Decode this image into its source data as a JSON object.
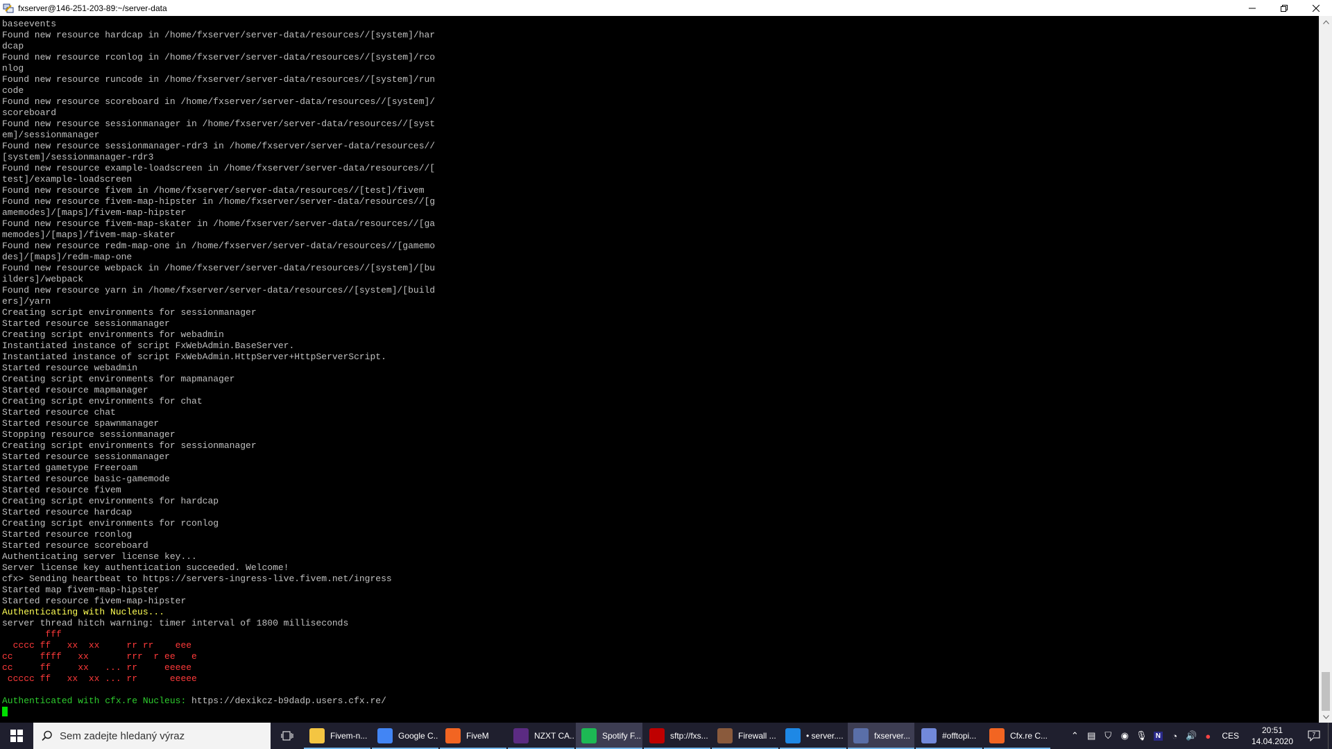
{
  "window": {
    "title": "fxserver@146-251-203-89:~/server-data"
  },
  "terminal": {
    "lines": [
      {
        "text": "baseevents",
        "color": "default"
      },
      {
        "text": "Found new resource hardcap in /home/fxserver/server-data/resources//[system]/har",
        "color": "default"
      },
      {
        "text": "dcap",
        "color": "default"
      },
      {
        "text": "Found new resource rconlog in /home/fxserver/server-data/resources//[system]/rco",
        "color": "default"
      },
      {
        "text": "nlog",
        "color": "default"
      },
      {
        "text": "Found new resource runcode in /home/fxserver/server-data/resources//[system]/run",
        "color": "default"
      },
      {
        "text": "code",
        "color": "default"
      },
      {
        "text": "Found new resource scoreboard in /home/fxserver/server-data/resources//[system]/",
        "color": "default"
      },
      {
        "text": "scoreboard",
        "color": "default"
      },
      {
        "text": "Found new resource sessionmanager in /home/fxserver/server-data/resources//[syst",
        "color": "default"
      },
      {
        "text": "em]/sessionmanager",
        "color": "default"
      },
      {
        "text": "Found new resource sessionmanager-rdr3 in /home/fxserver/server-data/resources//",
        "color": "default"
      },
      {
        "text": "[system]/sessionmanager-rdr3",
        "color": "default"
      },
      {
        "text": "Found new resource example-loadscreen in /home/fxserver/server-data/resources//[",
        "color": "default"
      },
      {
        "text": "test]/example-loadscreen",
        "color": "default"
      },
      {
        "text": "Found new resource fivem in /home/fxserver/server-data/resources//[test]/fivem",
        "color": "default"
      },
      {
        "text": "Found new resource fivem-map-hipster in /home/fxserver/server-data/resources//[g",
        "color": "default"
      },
      {
        "text": "amemodes]/[maps]/fivem-map-hipster",
        "color": "default"
      },
      {
        "text": "Found new resource fivem-map-skater in /home/fxserver/server-data/resources//[ga",
        "color": "default"
      },
      {
        "text": "memodes]/[maps]/fivem-map-skater",
        "color": "default"
      },
      {
        "text": "Found new resource redm-map-one in /home/fxserver/server-data/resources//[gamemo",
        "color": "default"
      },
      {
        "text": "des]/[maps]/redm-map-one",
        "color": "default"
      },
      {
        "text": "Found new resource webpack in /home/fxserver/server-data/resources//[system]/[bu",
        "color": "default"
      },
      {
        "text": "ilders]/webpack",
        "color": "default"
      },
      {
        "text": "Found new resource yarn in /home/fxserver/server-data/resources//[system]/[build",
        "color": "default"
      },
      {
        "text": "ers]/yarn",
        "color": "default"
      },
      {
        "text": "Creating script environments for sessionmanager",
        "color": "default"
      },
      {
        "text": "Started resource sessionmanager",
        "color": "default"
      },
      {
        "text": "Creating script environments for webadmin",
        "color": "default"
      },
      {
        "text": "Instantiated instance of script FxWebAdmin.BaseServer.",
        "color": "default"
      },
      {
        "text": "Instantiated instance of script FxWebAdmin.HttpServer+HttpServerScript.",
        "color": "default"
      },
      {
        "text": "Started resource webadmin",
        "color": "default"
      },
      {
        "text": "Creating script environments for mapmanager",
        "color": "default"
      },
      {
        "text": "Started resource mapmanager",
        "color": "default"
      },
      {
        "text": "Creating script environments for chat",
        "color": "default"
      },
      {
        "text": "Started resource chat",
        "color": "default"
      },
      {
        "text": "Started resource spawnmanager",
        "color": "default"
      },
      {
        "text": "Stopping resource sessionmanager",
        "color": "default"
      },
      {
        "text": "Creating script environments for sessionmanager",
        "color": "default"
      },
      {
        "text": "Started resource sessionmanager",
        "color": "default"
      },
      {
        "text": "Started gametype Freeroam",
        "color": "default"
      },
      {
        "text": "Started resource basic-gamemode",
        "color": "default"
      },
      {
        "text": "Started resource fivem",
        "color": "default"
      },
      {
        "text": "Creating script environments for hardcap",
        "color": "default"
      },
      {
        "text": "Started resource hardcap",
        "color": "default"
      },
      {
        "text": "Creating script environments for rconlog",
        "color": "default"
      },
      {
        "text": "Started resource rconlog",
        "color": "default"
      },
      {
        "text": "Started resource scoreboard",
        "color": "default"
      },
      {
        "text": "Authenticating server license key...",
        "color": "default"
      },
      {
        "text": "Server license key authentication succeeded. Welcome!",
        "color": "default"
      },
      {
        "text": "cfx> Sending heartbeat to https://servers-ingress-live.fivem.net/ingress",
        "color": "default"
      },
      {
        "text": "Started map fivem-map-hipster",
        "color": "default"
      },
      {
        "text": "Started resource fivem-map-hipster",
        "color": "default"
      },
      {
        "text": "Authenticating with Nucleus...",
        "color": "yellow"
      },
      {
        "text": "server thread hitch warning: timer interval of 1800 milliseconds",
        "color": "default"
      },
      {
        "text": "        fff",
        "color": "red"
      },
      {
        "text": "  cccc ff   xx  xx     rr rr    eee",
        "color": "red"
      },
      {
        "text": "cc     ffff   xx       rrr  r ee   e",
        "color": "red"
      },
      {
        "text": "cc     ff     xx   ... rr     eeeee",
        "color": "red"
      },
      {
        "text": " ccccc ff   xx  xx ... rr      eeeee",
        "color": "red"
      },
      {
        "text": "",
        "color": "default"
      },
      {
        "text": "Authenticated with cfx.re Nucleus: https://dexikcz-b9dadp.users.cfx.re/",
        "color": "green-prefix"
      }
    ]
  },
  "taskbar": {
    "search_placeholder": "Sem zadejte hledaný výraz",
    "apps": [
      {
        "label": "Fivem-n...",
        "icon": "folder-icon",
        "color": "#f4c542",
        "active": false,
        "underline": true
      },
      {
        "label": "Google C...",
        "icon": "chrome-icon",
        "color": "#4285f4",
        "active": false,
        "underline": true
      },
      {
        "label": "FiveM",
        "icon": "fivem-icon",
        "color": "#f26522",
        "active": false,
        "underline": true
      },
      {
        "label": "NZXT CA...",
        "icon": "nzxt-icon",
        "color": "#5b2b82",
        "active": false,
        "underline": true
      },
      {
        "label": "Spotify F...",
        "icon": "spotify-icon",
        "color": "#1db954",
        "active": true,
        "underline": true
      },
      {
        "label": "sftp://fxs...",
        "icon": "filezilla-icon",
        "color": "#bf0000",
        "active": false,
        "underline": true
      },
      {
        "label": "Firewall ...",
        "icon": "firewall-icon",
        "color": "#8a5a3c",
        "active": false,
        "underline": true
      },
      {
        "label": "• server....",
        "icon": "vscode-icon",
        "color": "#1e88e5",
        "active": false,
        "underline": true
      },
      {
        "label": "fxserver...",
        "icon": "putty-icon",
        "color": "#5a6fa8",
        "active": true,
        "underline": true
      },
      {
        "label": "#offtopi...",
        "icon": "discord-icon",
        "color": "#7289da",
        "active": false,
        "underline": true
      },
      {
        "label": "Cfx.re C...",
        "icon": "cfx-icon",
        "color": "#f26522",
        "active": false,
        "underline": true
      }
    ],
    "tray": {
      "language": "CES",
      "time": "20:51",
      "date": "14.04.2020"
    }
  }
}
